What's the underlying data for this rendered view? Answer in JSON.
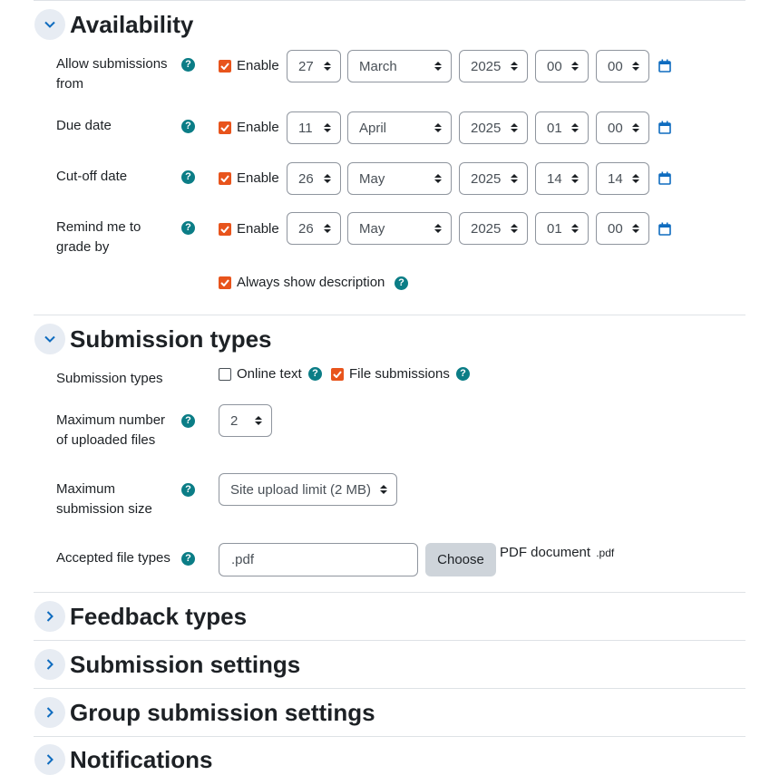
{
  "availability": {
    "title": "Availability",
    "rows": [
      {
        "label": "Allow submissions from",
        "enable": "Enable",
        "day": "27",
        "month": "March",
        "year": "2025",
        "hour": "00",
        "minute": "00"
      },
      {
        "label": "Due date",
        "enable": "Enable",
        "day": "11",
        "month": "April",
        "year": "2025",
        "hour": "01",
        "minute": "00"
      },
      {
        "label": "Cut-off date",
        "enable": "Enable",
        "day": "26",
        "month": "May",
        "year": "2025",
        "hour": "14",
        "minute": "14"
      },
      {
        "label": "Remind me to grade by",
        "enable": "Enable",
        "day": "26",
        "month": "May",
        "year": "2025",
        "hour": "01",
        "minute": "00"
      }
    ],
    "always_show_description": "Always show description"
  },
  "submission_types": {
    "title": "Submission types",
    "types_label": "Submission types",
    "online_text": "Online text",
    "file_submissions": "File submissions",
    "max_files_label": "Maximum number of uploaded files",
    "max_files_value": "2",
    "max_size_label": "Maximum submission size",
    "max_size_value": "Site upload limit (2 MB)",
    "accepted_label": "Accepted file types",
    "accepted_value": ".pdf",
    "choose_button": "Choose",
    "file_type_name": "PDF document",
    "file_type_ext": ".pdf"
  },
  "collapsed_sections": {
    "feedback": "Feedback types",
    "submission_settings": "Submission settings",
    "group_settings": "Group submission settings",
    "notifications": "Notifications"
  },
  "help_glyph": "?",
  "colors": {
    "accent": "#0f6cbf",
    "checkbox": "#e8541c",
    "help": "#0b7d86"
  }
}
